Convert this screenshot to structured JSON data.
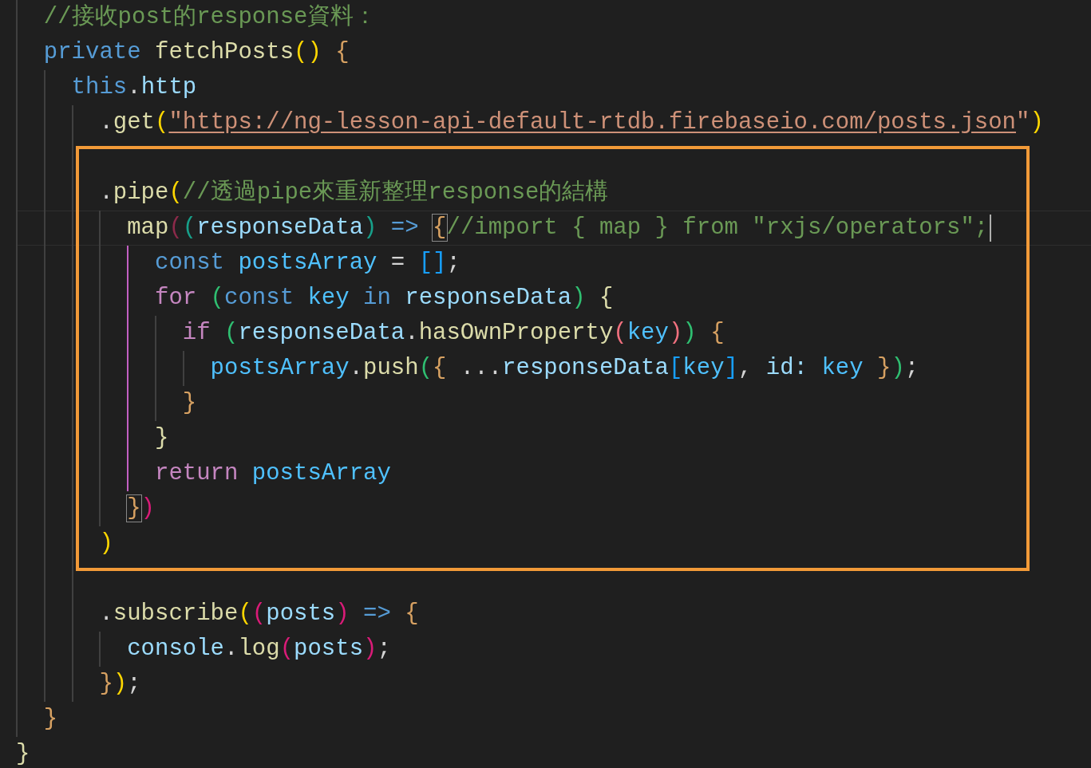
{
  "editor": {
    "lines": [
      {
        "guides": [
          {
            "active": false
          }
        ],
        "tokens": [
          {
            "text": "//接收post的response資料：",
            "kind": "comment"
          }
        ]
      },
      {
        "guides": [
          {
            "active": false
          }
        ],
        "tokens": [
          {
            "text": "private",
            "kind": "kw"
          },
          {
            "text": " fetchPosts",
            "kind": "fn"
          },
          {
            "text": "()",
            "kind": "gold"
          },
          {
            "text": " {",
            "kind": "brace"
          }
        ]
      },
      {
        "guides": [
          {
            "active": false
          },
          {
            "active": false
          }
        ],
        "tokens": [
          {
            "text": "this",
            "kind": "kw"
          },
          {
            "text": ".",
            "kind": "plain"
          },
          {
            "text": "http",
            "kind": "var"
          }
        ]
      },
      {
        "guides": [
          {
            "active": false
          },
          {
            "active": false
          },
          {
            "active": false
          }
        ],
        "tokens": [
          {
            "text": ".",
            "kind": "plain"
          },
          {
            "text": "get",
            "kind": "fn"
          },
          {
            "text": "(",
            "kind": "gold"
          },
          {
            "text": "\"https://ng-lesson-api-default-rtdb.firebaseio.com/posts.json",
            "kind": "link"
          },
          {
            "text": "\"",
            "kind": "str"
          },
          {
            "text": ")",
            "kind": "gold"
          }
        ]
      },
      {
        "guides": [
          {
            "active": false
          },
          {
            "active": false
          },
          {
            "active": false
          }
        ]
      },
      {
        "guides": [
          {
            "active": false
          },
          {
            "active": false
          },
          {
            "active": false
          }
        ],
        "tokens": [
          {
            "text": ".",
            "kind": "plain"
          },
          {
            "text": "pipe",
            "kind": "fn"
          },
          {
            "text": "(",
            "kind": "gold"
          },
          {
            "text": "//透過pipe來重新整理response的結構",
            "kind": "comment"
          }
        ]
      },
      {
        "guides": [
          {
            "active": false
          },
          {
            "active": false
          },
          {
            "active": false
          },
          {
            "active": false
          }
        ],
        "active": true,
        "cursor": true,
        "tokens": [
          {
            "text": "map",
            "kind": "fn"
          },
          {
            "text": "(",
            "kind": "dimred"
          },
          {
            "text": "(",
            "kind": "teal"
          },
          {
            "text": "responseData",
            "kind": "var"
          },
          {
            "text": ")",
            "kind": "teal"
          },
          {
            "text": " => ",
            "kind": "kw"
          },
          {
            "text": "{",
            "kind": "brace",
            "matched": true
          },
          {
            "text": "//import { map } from \"rxjs/operators\";",
            "kind": "comment"
          }
        ]
      },
      {
        "guides": [
          {
            "active": false
          },
          {
            "active": false
          },
          {
            "active": false
          },
          {
            "active": false
          },
          {
            "active": true
          }
        ],
        "tokens": [
          {
            "text": "const",
            "kind": "kw"
          },
          {
            "text": " postsArray",
            "kind": "const"
          },
          {
            "text": " = ",
            "kind": "plain"
          },
          {
            "text": "[]",
            "kind": "cyan"
          },
          {
            "text": ";",
            "kind": "plain"
          }
        ]
      },
      {
        "guides": [
          {
            "active": false
          },
          {
            "active": false
          },
          {
            "active": false
          },
          {
            "active": false
          },
          {
            "active": true
          }
        ],
        "tokens": [
          {
            "text": "for",
            "kind": "ctrl"
          },
          {
            "text": " (",
            "kind": "green"
          },
          {
            "text": "const",
            "kind": "kw"
          },
          {
            "text": " key",
            "kind": "const"
          },
          {
            "text": " in",
            "kind": "kw"
          },
          {
            "text": " responseData",
            "kind": "var"
          },
          {
            "text": ")",
            "kind": "green"
          },
          {
            "text": " {",
            "kind": "fn"
          }
        ]
      },
      {
        "guides": [
          {
            "active": false
          },
          {
            "active": false
          },
          {
            "active": false
          },
          {
            "active": false
          },
          {
            "active": true
          },
          {
            "active": false
          }
        ],
        "tokens": [
          {
            "text": "if",
            "kind": "ctrl"
          },
          {
            "text": " (",
            "kind": "green"
          },
          {
            "text": "responseData",
            "kind": "var"
          },
          {
            "text": ".",
            "kind": "plain"
          },
          {
            "text": "hasOwnProperty",
            "kind": "fn"
          },
          {
            "text": "(",
            "kind": "salmon"
          },
          {
            "text": "key",
            "kind": "const"
          },
          {
            "text": ")",
            "kind": "salmon"
          },
          {
            "text": ")",
            "kind": "green"
          },
          {
            "text": " {",
            "kind": "brace"
          }
        ]
      },
      {
        "guides": [
          {
            "active": false
          },
          {
            "active": false
          },
          {
            "active": false
          },
          {
            "active": false
          },
          {
            "active": true
          },
          {
            "active": false
          },
          {
            "active": false
          }
        ],
        "tokens": [
          {
            "text": "postsArray",
            "kind": "const"
          },
          {
            "text": ".",
            "kind": "plain"
          },
          {
            "text": "push",
            "kind": "fn"
          },
          {
            "text": "(",
            "kind": "green"
          },
          {
            "text": "{",
            "kind": "brace"
          },
          {
            "text": " ...",
            "kind": "plain"
          },
          {
            "text": "responseData",
            "kind": "var"
          },
          {
            "text": "[",
            "kind": "cyan"
          },
          {
            "text": "key",
            "kind": "const"
          },
          {
            "text": "]",
            "kind": "cyan"
          },
          {
            "text": ", ",
            "kind": "plain"
          },
          {
            "text": "id:",
            "kind": "var"
          },
          {
            "text": " key",
            "kind": "const"
          },
          {
            "text": " }",
            "kind": "brace"
          },
          {
            "text": ")",
            "kind": "green"
          },
          {
            "text": ";",
            "kind": "plain"
          }
        ]
      },
      {
        "guides": [
          {
            "active": false
          },
          {
            "active": false
          },
          {
            "active": false
          },
          {
            "active": false
          },
          {
            "active": true
          },
          {
            "active": false
          }
        ],
        "tokens": [
          {
            "text": "}",
            "kind": "brace"
          }
        ]
      },
      {
        "guides": [
          {
            "active": false
          },
          {
            "active": false
          },
          {
            "active": false
          },
          {
            "active": false
          },
          {
            "active": true
          }
        ],
        "tokens": [
          {
            "text": "}",
            "kind": "fn"
          }
        ]
      },
      {
        "guides": [
          {
            "active": false
          },
          {
            "active": false
          },
          {
            "active": false
          },
          {
            "active": false
          },
          {
            "active": true
          }
        ],
        "tokens": [
          {
            "text": "return",
            "kind": "ctrl"
          },
          {
            "text": " postsArray",
            "kind": "const"
          }
        ]
      },
      {
        "guides": [
          {
            "active": false
          },
          {
            "active": false
          },
          {
            "active": false
          },
          {
            "active": false
          }
        ],
        "tokens": [
          {
            "text": "}",
            "kind": "brace",
            "matched": true
          },
          {
            "text": ")",
            "kind": "magenta"
          }
        ]
      },
      {
        "guides": [
          {
            "active": false
          },
          {
            "active": false
          },
          {
            "active": false
          }
        ],
        "tokens": [
          {
            "text": ")",
            "kind": "gold"
          }
        ]
      },
      {
        "guides": [
          {
            "active": false
          },
          {
            "active": false
          },
          {
            "active": false
          }
        ]
      },
      {
        "guides": [
          {
            "active": false
          },
          {
            "active": false
          },
          {
            "active": false
          }
        ],
        "tokens": [
          {
            "text": ".",
            "kind": "plain"
          },
          {
            "text": "subscribe",
            "kind": "fn"
          },
          {
            "text": "(",
            "kind": "gold"
          },
          {
            "text": "(",
            "kind": "magenta"
          },
          {
            "text": "posts",
            "kind": "var"
          },
          {
            "text": ")",
            "kind": "magenta"
          },
          {
            "text": " =>",
            "kind": "kw"
          },
          {
            "text": " {",
            "kind": "brace"
          }
        ]
      },
      {
        "guides": [
          {
            "active": false
          },
          {
            "active": false
          },
          {
            "active": false
          },
          {
            "active": false
          }
        ],
        "tokens": [
          {
            "text": "console",
            "kind": "var"
          },
          {
            "text": ".",
            "kind": "plain"
          },
          {
            "text": "log",
            "kind": "fn"
          },
          {
            "text": "(",
            "kind": "magenta"
          },
          {
            "text": "posts",
            "kind": "var"
          },
          {
            "text": ")",
            "kind": "magenta"
          },
          {
            "text": ";",
            "kind": "plain"
          }
        ]
      },
      {
        "guides": [
          {
            "active": false
          },
          {
            "active": false
          },
          {
            "active": false
          }
        ],
        "tokens": [
          {
            "text": "}",
            "kind": "brace"
          },
          {
            "text": ")",
            "kind": "gold"
          },
          {
            "text": ";",
            "kind": "plain"
          }
        ]
      },
      {
        "guides": [
          {
            "active": false
          }
        ],
        "tokens": [
          {
            "text": "}",
            "kind": "brace"
          }
        ]
      },
      {
        "tokens": [
          {
            "text": "}",
            "kind": "fn"
          }
        ]
      }
    ]
  }
}
